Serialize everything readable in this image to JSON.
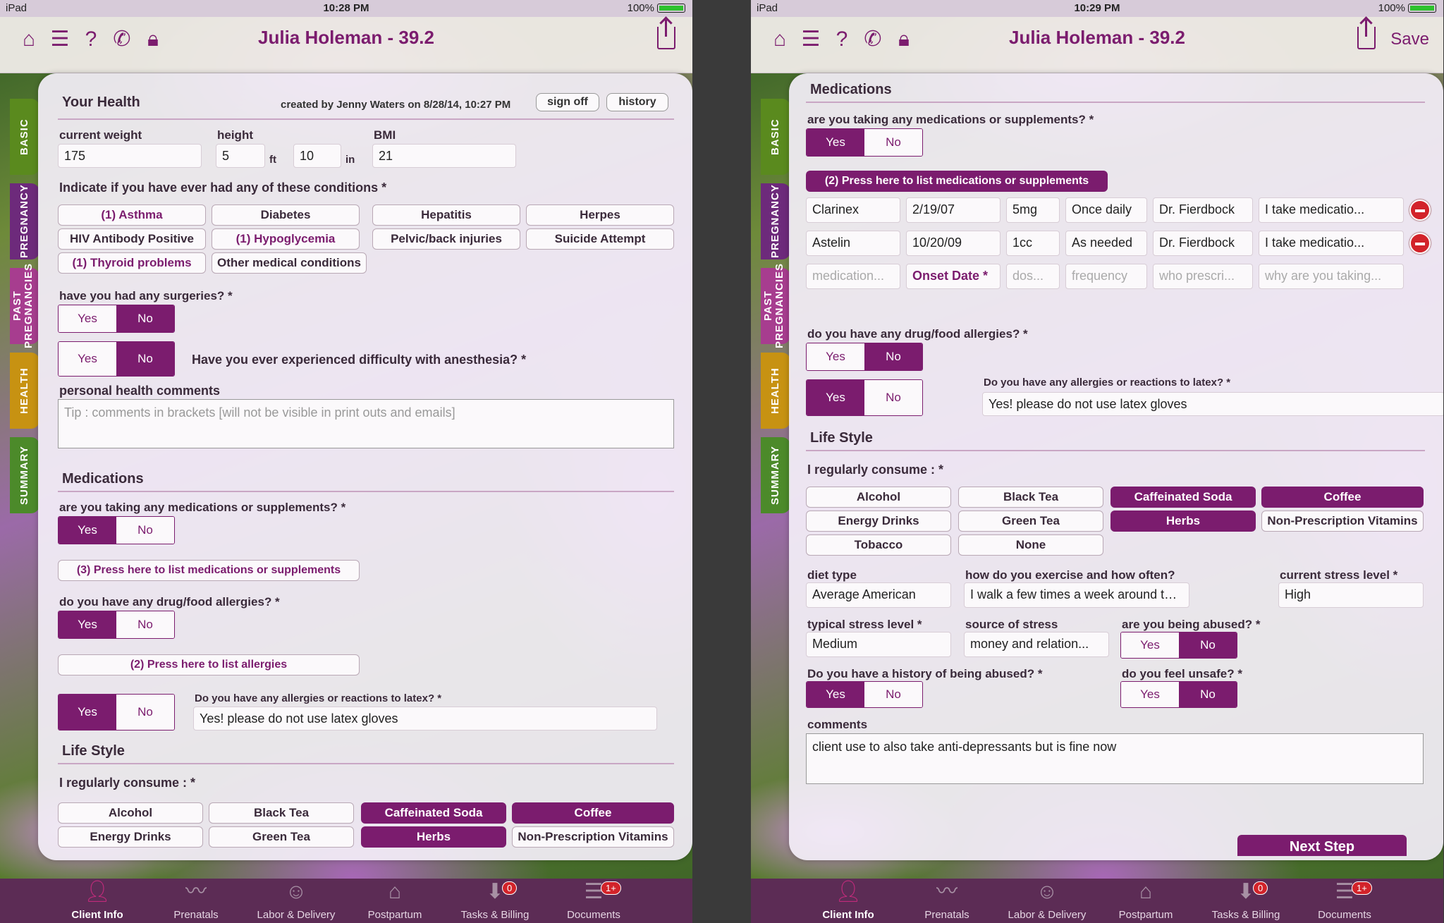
{
  "status": {
    "carrier": "iPad",
    "time_left": "10:28 PM",
    "time_right": "10:29 PM",
    "battery": "100%"
  },
  "header": {
    "title": "Julia Holeman - 39.2",
    "save_label": "Save"
  },
  "side_tabs": [
    "BASIC",
    "PREGNANCY",
    "PAST PREGNANCIES",
    "HEALTH",
    "SUMMARY"
  ],
  "left": {
    "your_health": "Your Health",
    "created": "created by Jenny Waters on 8/28/14, 10:27 PM",
    "sign_off": "sign off",
    "history": "history",
    "weight_label": "current weight",
    "weight": "175",
    "height_label": "height",
    "height_ft": "5",
    "ft": "ft",
    "height_in": "10",
    "in": "in",
    "bmi_label": "BMI",
    "bmi": "21",
    "conditions_q": "Indicate if you have ever had any of these conditions *",
    "conditions": [
      "(1) Asthma",
      "Diabetes",
      "Hepatitis",
      "Herpes",
      "HIV Antibody Positive",
      "(1) Hypoglycemia",
      "Pelvic/back injuries",
      "Suicide Attempt",
      "(1) Thyroid problems",
      "Other medical conditions"
    ],
    "surgeries_q": "have you had any surgeries? *",
    "anesthesia_q": "Have you ever experienced difficulty with anesthesia? *",
    "comments_label": "personal health comments",
    "comments_ph": "Tip : comments in brackets [will not be visible in print outs and emails]",
    "medications": "Medications",
    "meds_q": "are you taking any medications or supplements? *",
    "meds_btn": "(3) Press here to list medications or supplements",
    "allergies_q": "do you have any drug/food allergies? *",
    "allergies_btn": "(2) Press here to list allergies",
    "latex_q": "Do you have any allergies or reactions to latex? *",
    "latex_answer": "Yes! please do not use latex gloves",
    "lifestyle": "Life Style",
    "consume_q": "I regularly consume : *",
    "consume": [
      "Alcohol",
      "Black Tea",
      "Caffeinated Soda",
      "Coffee",
      "Energy Drinks",
      "Green Tea",
      "Herbs",
      "Non-Prescription Vitamins"
    ]
  },
  "right": {
    "medications": "Medications",
    "meds_q": "are you taking any medications or supplements? *",
    "meds_btn": "(2) Press here to list medications or supplements",
    "meds": [
      [
        "Clarinex",
        "2/19/07",
        "5mg",
        "Once daily",
        "Dr. Fierdbock",
        "I take medicatio..."
      ],
      [
        "Astelin",
        "10/20/09",
        "1cc",
        "As needed",
        "Dr. Fierdbock",
        "I take medicatio..."
      ]
    ],
    "med_placeholders": [
      "medication...",
      "Onset Date *",
      "dos...",
      "frequency",
      "who prescri...",
      "why are you taking..."
    ],
    "allergies_q": "do you have any drug/food allergies? *",
    "latex_q": "Do you have any allergies or reactions to latex? *",
    "latex_answer": "Yes! please do not use latex gloves",
    "lifestyle": "Life Style",
    "consume_q": "I regularly consume : *",
    "consume": [
      "Alcohol",
      "Black Tea",
      "Caffeinated Soda",
      "Coffee",
      "Energy Drinks",
      "Green Tea",
      "Herbs",
      "Non-Prescription Vitamins",
      "Tobacco",
      "None"
    ],
    "diet_label": "diet type",
    "diet": "Average American",
    "exercise_label": "how do you exercise and how often?",
    "exercise": "I walk a few times a week around the neighbo...",
    "cur_stress_label": "current stress level *",
    "cur_stress": "High",
    "typ_stress_label": "typical stress level *",
    "typ_stress": "Medium",
    "source_label": "source of stress",
    "source": "money and relation...",
    "abused_q": "are you being abused? *",
    "abuse_hist_q": "Do you have a history of being abused? *",
    "unsafe_q": "do you feel unsafe? *",
    "comments_label": "comments",
    "comments": "client use to also take anti-depressants but is fine now",
    "next_step": "Next Step"
  },
  "yn": {
    "yes": "Yes",
    "no": "No"
  },
  "tabbar": [
    {
      "label": "Client Info",
      "icon": "person-icon"
    },
    {
      "label": "Prenatals",
      "icon": "heartbeat-icon"
    },
    {
      "label": "Labor & Delivery",
      "icon": "baby-icon"
    },
    {
      "label": "Postpartum",
      "icon": "house-icon"
    },
    {
      "label": "Tasks & Billing",
      "icon": "inbox-icon",
      "badge": "0"
    },
    {
      "label": "Documents",
      "icon": "documents-icon",
      "badge": "1+"
    }
  ],
  "colors": {
    "accent": "#7b1c6e"
  }
}
